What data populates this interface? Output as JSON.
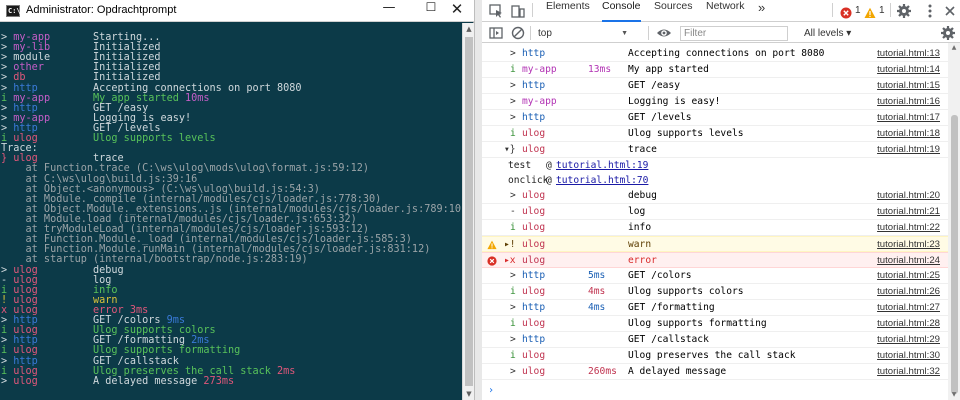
{
  "colors": {
    "terminal_bg": "#0c3a48",
    "magenta": "#c55ec7",
    "red": "#e0577a",
    "blue": "#3a7ad8",
    "green": "#58c25a",
    "yellow": "#d8c23a",
    "grey": "#cfd8dc",
    "accent": "#1a73e8"
  },
  "terminal": {
    "title": "Administrator: Opdrachtprompt",
    "app_icon_text": "C:\\",
    "minimize_glyph": "—",
    "maximize_glyph": "☐",
    "close_glyph": "✕",
    "lines": [
      {
        "segs": [
          {
            "t": "> ",
            "c": "c-grey"
          },
          {
            "t": "my-app       ",
            "c": "c-mag"
          },
          {
            "t": "Starting...",
            "c": "c-grey"
          }
        ]
      },
      {
        "segs": [
          {
            "t": "> ",
            "c": "c-grey"
          },
          {
            "t": "my-lib       ",
            "c": "c-mag"
          },
          {
            "t": "Initialized",
            "c": "c-grey"
          }
        ]
      },
      {
        "segs": [
          {
            "t": "> ",
            "c": "c-grey"
          },
          {
            "t": "module       ",
            "c": "c-grey"
          },
          {
            "t": "Initialized",
            "c": "c-grey"
          }
        ]
      },
      {
        "segs": [
          {
            "t": "> ",
            "c": "c-grey"
          },
          {
            "t": "other        ",
            "c": "c-mag"
          },
          {
            "t": "Initialized",
            "c": "c-grey"
          }
        ]
      },
      {
        "segs": [
          {
            "t": "> ",
            "c": "c-grey"
          },
          {
            "t": "db           ",
            "c": "c-red"
          },
          {
            "t": "Initialized",
            "c": "c-grey"
          }
        ]
      },
      {
        "segs": [
          {
            "t": "> ",
            "c": "c-grey"
          },
          {
            "t": "http         ",
            "c": "c-blue"
          },
          {
            "t": "Accepting connections on port 8080",
            "c": "c-grey"
          }
        ]
      },
      {
        "segs": [
          {
            "t": "i ",
            "c": "c-green"
          },
          {
            "t": "my-app       ",
            "c": "c-mag"
          },
          {
            "t": "My app started ",
            "c": "c-green"
          },
          {
            "t": "10ms",
            "c": "c-mag"
          }
        ]
      },
      {
        "segs": [
          {
            "t": "> ",
            "c": "c-grey"
          },
          {
            "t": "http         ",
            "c": "c-blue"
          },
          {
            "t": "GET /easy",
            "c": "c-grey"
          }
        ]
      },
      {
        "segs": [
          {
            "t": "> ",
            "c": "c-grey"
          },
          {
            "t": "my-app       ",
            "c": "c-mag"
          },
          {
            "t": "Logging is easy!",
            "c": "c-grey"
          }
        ]
      },
      {
        "segs": [
          {
            "t": "> ",
            "c": "c-grey"
          },
          {
            "t": "http         ",
            "c": "c-blue"
          },
          {
            "t": "GET /levels",
            "c": "c-grey"
          }
        ]
      },
      {
        "segs": [
          {
            "t": "i ",
            "c": "c-green"
          },
          {
            "t": "ulog         ",
            "c": "c-red"
          },
          {
            "t": "Ulog supports levels",
            "c": "c-green"
          }
        ]
      },
      {
        "segs": [
          {
            "t": "Trace:",
            "c": "c-grey"
          }
        ]
      },
      {
        "segs": [
          {
            "t": "} ",
            "c": "c-red"
          },
          {
            "t": "ulog         ",
            "c": "c-red"
          },
          {
            "t": "trace",
            "c": "c-grey"
          }
        ]
      },
      {
        "segs": [
          {
            "t": "    at Function.trace (C:\\ws\\ulog\\mods\\ulog\\format.js:59:12)",
            "c": "c-dgrey"
          }
        ]
      },
      {
        "segs": [
          {
            "t": "    at C:\\ws\\ulog\\build.js:39:16",
            "c": "c-dgrey"
          }
        ]
      },
      {
        "segs": [
          {
            "t": "    at Object.<anonymous> (C:\\ws\\ulog\\build.js:54:3)",
            "c": "c-dgrey"
          }
        ]
      },
      {
        "segs": [
          {
            "t": "    at Module._compile (internal/modules/cjs/loader.js:778:30)",
            "c": "c-dgrey"
          }
        ]
      },
      {
        "segs": [
          {
            "t": "    at Object.Module._extensions..js (internal/modules/cjs/loader.js:789:10)",
            "c": "c-dgrey"
          }
        ]
      },
      {
        "segs": [
          {
            "t": "    at Module.load (internal/modules/cjs/loader.js:653:32)",
            "c": "c-dgrey"
          }
        ]
      },
      {
        "segs": [
          {
            "t": "    at tryModuleLoad (internal/modules/cjs/loader.js:593:12)",
            "c": "c-dgrey"
          }
        ]
      },
      {
        "segs": [
          {
            "t": "    at Function.Module._load (internal/modules/cjs/loader.js:585:3)",
            "c": "c-dgrey"
          }
        ]
      },
      {
        "segs": [
          {
            "t": "    at Function.Module.runMain (internal/modules/cjs/loader.js:831:12)",
            "c": "c-dgrey"
          }
        ]
      },
      {
        "segs": [
          {
            "t": "    at startup (internal/bootstrap/node.js:283:19)",
            "c": "c-dgrey"
          }
        ]
      },
      {
        "segs": [
          {
            "t": "> ",
            "c": "c-grey"
          },
          {
            "t": "ulog         ",
            "c": "c-red"
          },
          {
            "t": "debug",
            "c": "c-grey"
          }
        ]
      },
      {
        "segs": [
          {
            "t": "- ",
            "c": "c-grey"
          },
          {
            "t": "ulog         ",
            "c": "c-red"
          },
          {
            "t": "log",
            "c": "c-grey"
          }
        ]
      },
      {
        "segs": [
          {
            "t": "i ",
            "c": "c-green"
          },
          {
            "t": "ulog         ",
            "c": "c-red"
          },
          {
            "t": "info",
            "c": "c-green"
          }
        ]
      },
      {
        "segs": [
          {
            "t": "! ",
            "c": "c-yellow"
          },
          {
            "t": "ulog         ",
            "c": "c-red"
          },
          {
            "t": "warn",
            "c": "c-yellow"
          }
        ]
      },
      {
        "segs": [
          {
            "t": "x ",
            "c": "c-red"
          },
          {
            "t": "ulog         ",
            "c": "c-red"
          },
          {
            "t": "error ",
            "c": "c-red"
          },
          {
            "t": "3ms",
            "c": "c-red"
          }
        ]
      },
      {
        "segs": [
          {
            "t": "> ",
            "c": "c-grey"
          },
          {
            "t": "http         ",
            "c": "c-blue"
          },
          {
            "t": "GET /colors ",
            "c": "c-grey"
          },
          {
            "t": "9ms",
            "c": "c-blue"
          }
        ]
      },
      {
        "segs": [
          {
            "t": "i ",
            "c": "c-green"
          },
          {
            "t": "ulog         ",
            "c": "c-red"
          },
          {
            "t": "Ulog supports colors",
            "c": "c-green"
          }
        ]
      },
      {
        "segs": [
          {
            "t": "> ",
            "c": "c-grey"
          },
          {
            "t": "http         ",
            "c": "c-blue"
          },
          {
            "t": "GET /formatting ",
            "c": "c-grey"
          },
          {
            "t": "2ms",
            "c": "c-blue"
          }
        ]
      },
      {
        "segs": [
          {
            "t": "i ",
            "c": "c-green"
          },
          {
            "t": "ulog         ",
            "c": "c-red"
          },
          {
            "t": "Ulog supports formatting",
            "c": "c-green"
          }
        ]
      },
      {
        "segs": [
          {
            "t": "> ",
            "c": "c-grey"
          },
          {
            "t": "http         ",
            "c": "c-blue"
          },
          {
            "t": "GET /callstack",
            "c": "c-grey"
          }
        ]
      },
      {
        "segs": [
          {
            "t": "i ",
            "c": "c-green"
          },
          {
            "t": "ulog         ",
            "c": "c-red"
          },
          {
            "t": "Ulog preserves the call stack ",
            "c": "c-green"
          },
          {
            "t": "2ms",
            "c": "c-red"
          }
        ]
      },
      {
        "segs": [
          {
            "t": "> ",
            "c": "c-grey"
          },
          {
            "t": "ulog         ",
            "c": "c-red"
          },
          {
            "t": "A delayed message ",
            "c": "c-grey"
          },
          {
            "t": "273ms",
            "c": "c-red"
          }
        ]
      }
    ]
  },
  "devtools": {
    "tabs": [
      {
        "label": "Elements",
        "active": false
      },
      {
        "label": "Console",
        "active": true
      },
      {
        "label": "Sources",
        "active": false
      },
      {
        "label": "Network",
        "active": false
      }
    ],
    "more_tabs_glyph": "»",
    "error_count": "1",
    "warning_count": "1",
    "context": "top",
    "filter_placeholder": "Filter",
    "levels_label": "All levels ▾",
    "prompt": "›",
    "rows": [
      {
        "kind": "log",
        "pre": ">",
        "pre_color": "#333333",
        "cat": "http",
        "cat_color": "#1a5fb4",
        "dur": "",
        "dur_color": "#1a5fb4",
        "msg": "Accepting connections on port 8080",
        "src": "tutorial.html:13"
      },
      {
        "kind": "log",
        "pre": "i",
        "pre_color": "#2e8b2e",
        "cat": "my-app",
        "cat_color": "#b233b4",
        "dur": "13ms",
        "dur_color": "#b233b4",
        "msg": "My app started",
        "src": "tutorial.html:14"
      },
      {
        "kind": "log",
        "pre": ">",
        "pre_color": "#333333",
        "cat": "http",
        "cat_color": "#1a5fb4",
        "dur": "",
        "dur_color": "#1a5fb4",
        "msg": "GET /easy",
        "src": "tutorial.html:15"
      },
      {
        "kind": "log",
        "pre": ">",
        "pre_color": "#333333",
        "cat": "my-app",
        "cat_color": "#b233b4",
        "dur": "",
        "dur_color": "#b233b4",
        "msg": "Logging is easy!",
        "src": "tutorial.html:16"
      },
      {
        "kind": "log",
        "pre": ">",
        "pre_color": "#333333",
        "cat": "http",
        "cat_color": "#1a5fb4",
        "dur": "",
        "dur_color": "#1a5fb4",
        "msg": "GET /levels",
        "src": "tutorial.html:17"
      },
      {
        "kind": "log",
        "pre": "i",
        "pre_color": "#2e8b2e",
        "cat": "ulog",
        "cat_color": "#c0334f",
        "dur": "",
        "dur_color": "#c0334f",
        "msg": "Ulog supports levels",
        "src": "tutorial.html:18"
      },
      {
        "kind": "trace",
        "pre": "▾}",
        "pre_color": "#333333",
        "cat": "ulog",
        "cat_color": "#c0334f",
        "dur": "",
        "dur_color": "#c0334f",
        "msg": "trace",
        "src": "tutorial.html:19"
      },
      {
        "kind": "stack",
        "fn": "test",
        "at": "@",
        "loc": "tutorial.html:19"
      },
      {
        "kind": "stack",
        "fn": "onclick",
        "at": "@",
        "loc": "tutorial.html:70"
      },
      {
        "kind": "log",
        "pre": ">",
        "pre_color": "#333333",
        "cat": "ulog",
        "cat_color": "#c0334f",
        "dur": "",
        "dur_color": "#c0334f",
        "msg": "debug",
        "src": "tutorial.html:20"
      },
      {
        "kind": "log",
        "pre": "-",
        "pre_color": "#333333",
        "cat": "ulog",
        "cat_color": "#c0334f",
        "dur": "",
        "dur_color": "#c0334f",
        "msg": "log",
        "src": "tutorial.html:21"
      },
      {
        "kind": "log",
        "pre": "i",
        "pre_color": "#2e8b2e",
        "cat": "ulog",
        "cat_color": "#c0334f",
        "dur": "",
        "dur_color": "#c0334f",
        "msg": "info",
        "src": "tutorial.html:22"
      },
      {
        "kind": "warn",
        "pre": "▸!",
        "pre_color": "#5c3c00",
        "cat": "ulog",
        "cat_color": "#c0334f",
        "dur": "",
        "dur_color": "#c0334f",
        "msg": "warn",
        "src": "tutorial.html:23"
      },
      {
        "kind": "err",
        "pre": "▸x",
        "pre_color": "#d82a2a",
        "cat": "ulog",
        "cat_color": "#c0334f",
        "dur": "",
        "dur_color": "#c0334f",
        "msg": "error",
        "src": "tutorial.html:24"
      },
      {
        "kind": "log",
        "pre": ">",
        "pre_color": "#333333",
        "cat": "http",
        "cat_color": "#1a5fb4",
        "dur": "5ms",
        "dur_color": "#1a5fb4",
        "msg": "GET /colors",
        "src": "tutorial.html:25"
      },
      {
        "kind": "log",
        "pre": "i",
        "pre_color": "#2e8b2e",
        "cat": "ulog",
        "cat_color": "#c0334f",
        "dur": "4ms",
        "dur_color": "#c0334f",
        "msg": "Ulog supports colors",
        "src": "tutorial.html:26"
      },
      {
        "kind": "log",
        "pre": ">",
        "pre_color": "#333333",
        "cat": "http",
        "cat_color": "#1a5fb4",
        "dur": "4ms",
        "dur_color": "#1a5fb4",
        "msg": "GET /formatting",
        "src": "tutorial.html:27"
      },
      {
        "kind": "log",
        "pre": "i",
        "pre_color": "#2e8b2e",
        "cat": "ulog",
        "cat_color": "#c0334f",
        "dur": "",
        "dur_color": "#c0334f",
        "msg": "Ulog supports formatting",
        "src": "tutorial.html:28"
      },
      {
        "kind": "log",
        "pre": ">",
        "pre_color": "#333333",
        "cat": "http",
        "cat_color": "#1a5fb4",
        "dur": "",
        "dur_color": "#1a5fb4",
        "msg": "GET /callstack",
        "src": "tutorial.html:29"
      },
      {
        "kind": "log",
        "pre": "i",
        "pre_color": "#2e8b2e",
        "cat": "ulog",
        "cat_color": "#c0334f",
        "dur": "",
        "dur_color": "#c0334f",
        "msg": "Ulog preserves the call stack",
        "src": "tutorial.html:30"
      },
      {
        "kind": "log",
        "pre": ">",
        "pre_color": "#333333",
        "cat": "ulog",
        "cat_color": "#c0334f",
        "dur": "260ms",
        "dur_color": "#c0334f",
        "msg": "A delayed message",
        "src": "tutorial.html:32"
      }
    ]
  }
}
